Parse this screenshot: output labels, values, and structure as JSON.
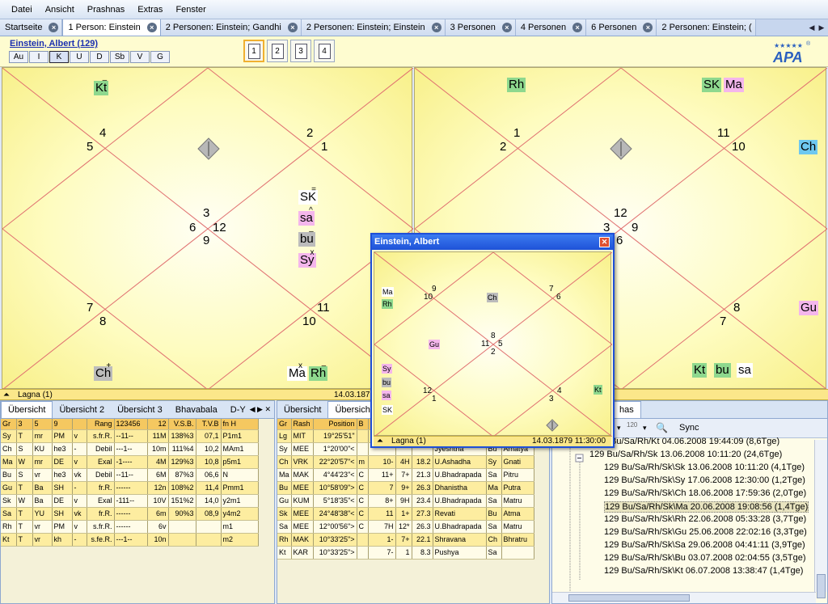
{
  "menu": [
    "Datei",
    "Ansicht",
    "Prashnas",
    "Extras",
    "Fenster"
  ],
  "tabs": [
    {
      "label": "Startseite",
      "active": false
    },
    {
      "label": "1 Person: Einstein",
      "active": true
    },
    {
      "label": "2 Personen: Einstein; Gandhi",
      "active": false
    },
    {
      "label": "2 Personen: Einstein; Einstein",
      "active": false
    },
    {
      "label": "3 Personen",
      "active": false
    },
    {
      "label": "4 Personen",
      "active": false
    },
    {
      "label": "6 Personen",
      "active": false
    },
    {
      "label": "2 Personen: Einstein; (",
      "active": false
    }
  ],
  "header": {
    "person": "Einstein, Albert (129)",
    "divisions": [
      "Au",
      "I",
      "K",
      "U",
      "D",
      "Sb",
      "V",
      "G"
    ],
    "selected_division": "K",
    "pages": [
      "1",
      "2",
      "3",
      "4"
    ],
    "selected_page": "1",
    "logo": "APA",
    "logo_reg": "®"
  },
  "left_chart": {
    "houses": [
      "4",
      "5",
      "2",
      "1",
      "3",
      "6",
      "12",
      "9",
      "7",
      "8",
      "11",
      "10"
    ],
    "planets": [
      {
        "name": "Kt",
        "mark": "–",
        "bg": "#8ed88e"
      },
      {
        "name": "SK",
        "mark": "=",
        "bg": "#ffffff"
      },
      {
        "name": "sa",
        "mark": "^",
        "bg": "#f4b6ec"
      },
      {
        "name": "bu",
        "mark": "–",
        "bg": "#bcbcbc"
      },
      {
        "name": "Sy",
        "mark": "x",
        "bg": "#f4b6ec"
      },
      {
        "name": "Ch",
        "mark": "+",
        "bg": "#bcbcbc"
      },
      {
        "name": "Ma",
        "mark": "x",
        "bg": "#ffffff"
      },
      {
        "name": "Rh",
        "mark": "–",
        "bg": "#8ed88e"
      }
    ]
  },
  "right_chart": {
    "houses": [
      "1",
      "2",
      "11",
      "10",
      "12",
      "3",
      "9",
      "6",
      "8",
      "7"
    ],
    "planets": [
      {
        "name": "Rh",
        "bg": "#8ed88e"
      },
      {
        "name": "SK",
        "bg": "#8ed88e"
      },
      {
        "name": "Ma",
        "bg": "#f4b6ec"
      },
      {
        "name": "Ch",
        "bg": "#6ec8f0"
      },
      {
        "name": "Gu",
        "bg": "#f4b6ec"
      },
      {
        "name": "Kt",
        "bg": "#8ed88e"
      },
      {
        "name": "bu",
        "bg": "#8ed88e"
      },
      {
        "name": "sa",
        "bg": "#ffffff"
      }
    ]
  },
  "chart_status": {
    "label": "Lagna (1)",
    "date": "14.03.1879"
  },
  "panel1": {
    "tabs": [
      "Übersicht",
      "Übersicht 2",
      "Übersicht 3",
      "Bhavabala",
      "D-Y"
    ],
    "header": [
      "Gr",
      "3",
      "5",
      "9",
      "",
      "",
      "Rang",
      "123456",
      "12",
      "V.S.B.",
      "T.V.B",
      "fn H"
    ],
    "rows": [
      [
        "Sy",
        "T",
        "mr",
        "PM",
        "v",
        "s.fr.R.",
        "--11--",
        "11M",
        "138%3",
        "07,1",
        "P1m1"
      ],
      [
        "Ch",
        "S",
        "KU",
        "he3",
        "-",
        "Debil",
        "---1--",
        "10m",
        "111%4",
        "10,2",
        "MAm1"
      ],
      [
        "Ma",
        "W",
        "mr",
        "DE",
        "v",
        "Exal",
        "-1----",
        "4M",
        "129%3",
        "10,8",
        "p5m1"
      ],
      [
        "Bu",
        "S",
        "vr",
        "he3",
        "vk",
        "Debil",
        "--11--",
        "6M",
        "87%3",
        "06,6",
        "N"
      ],
      [
        "Gu",
        "T",
        "Ba",
        "SH",
        "-",
        "fr.R.",
        "------",
        "12n",
        "108%2",
        "11,4",
        "Pmm1"
      ],
      [
        "Sk",
        "W",
        "Ba",
        "DE",
        "v",
        "Exal",
        "-111--",
        "10V",
        "151%2",
        "14,0",
        "y2m1"
      ],
      [
        "Sa",
        "T",
        "YU",
        "SH",
        "vk",
        "fr.R.",
        "------",
        "6m",
        "90%3",
        "08,9",
        "y4m2"
      ],
      [
        "Rh",
        "T",
        "vr",
        "PM",
        "v",
        "s.fr.R.",
        "------",
        "6v",
        "",
        "",
        "m1"
      ],
      [
        "Kt",
        "T",
        "vr",
        "kh",
        "-",
        "s.fe.R.",
        "---1--",
        "10n",
        "",
        "",
        "m2"
      ]
    ]
  },
  "panel2": {
    "tabs": [
      "Übersicht",
      "Übersicht"
    ],
    "header": [
      "Gr",
      "Rash",
      "Position",
      "B"
    ],
    "rows": [
      [
        "Lg",
        "MIT",
        "19°25'51\"",
        "",
        "",
        "",
        "",
        "",
        "",
        ""
      ],
      [
        "Sy",
        "MEE",
        "1°20'00\"<",
        "",
        "",
        "",
        "",
        "Jyeshtha",
        "Bu",
        "Amatya"
      ],
      [
        "Ch",
        "VRK",
        "22°20'57\"<",
        "m",
        "10-",
        "4H",
        "18.2",
        "U.Ashadha",
        "Sy",
        "Gnati"
      ],
      [
        "Ma",
        "MAK",
        "4°44'23\"<",
        "C",
        "11+",
        "7+",
        "21.3",
        "U.Bhadrapada",
        "Sa",
        "Pitru"
      ],
      [
        "Bu",
        "MEE",
        "10°58'09\">",
        "C",
        "7",
        "9+",
        "26.3",
        "Dhanistha",
        "Ma",
        "Putra"
      ],
      [
        "Gu",
        "KUM",
        "5°18'35\"<",
        "C",
        "8+",
        "9H",
        "23.4",
        "U.Bhadrapada",
        "Sa",
        "Matru"
      ],
      [
        "Sk",
        "MEE",
        "24°48'38\"<",
        "C",
        "11",
        "1+",
        "27.3",
        "Revati",
        "Bu",
        "Atma"
      ],
      [
        "Sa",
        "MEE",
        "12°00'56\">",
        "C",
        "7H",
        "12*",
        "26.3",
        "U.Bhadrapada",
        "Sa",
        "Matru"
      ],
      [
        "Rh",
        "MAK",
        "10°33'25\">",
        "",
        "1-",
        "7+",
        "22.1",
        "Shravana",
        "Ch",
        "Bhratru"
      ],
      [
        "Kt",
        "KAR",
        "10°33'25\">",
        "",
        "7-",
        "1",
        "8.3",
        "Pushya",
        "Sa",
        ""
      ]
    ]
  },
  "panel3": {
    "tab_suffix": "has",
    "toolbar": {
      "sync": "Sync",
      "zoom": "120"
    },
    "items": [
      {
        "text": "Bu/Sa/Rh/Kt 04.06.2008 19:44:09 (8,6Tge)",
        "level": 1
      },
      {
        "text": "129 Bu/Sa/Rh/Sk 13.06.2008 10:11:20 (24,6Tge)",
        "level": 1
      },
      {
        "text": "129 Bu/Sa/Rh/Sk\\Sk 13.06.2008 10:11:20 (4,1Tge)",
        "level": 2
      },
      {
        "text": "129 Bu/Sa/Rh/Sk\\Sy 17.06.2008 12:30:00 (1,2Tge)",
        "level": 2
      },
      {
        "text": "129 Bu/Sa/Rh/Sk\\Ch 18.06.2008 17:59:36 (2,0Tge)",
        "level": 2
      },
      {
        "text": "129 Bu/Sa/Rh/Sk\\Ma 20.06.2008 19:08:56 (1,4Tge)",
        "level": 2,
        "sel": true
      },
      {
        "text": "129 Bu/Sa/Rh/Sk\\Rh 22.06.2008 05:33:28 (3,7Tge)",
        "level": 2
      },
      {
        "text": "129 Bu/Sa/Rh/Sk\\Gu 25.06.2008 22:02:16 (3,3Tge)",
        "level": 2
      },
      {
        "text": "129 Bu/Sa/Rh/Sk\\Sa 29.06.2008 04:41:11 (3,9Tge)",
        "level": 2
      },
      {
        "text": "129 Bu/Sa/Rh/Sk\\Bu 03.07.2008 02:04:55 (3,5Tge)",
        "level": 2
      },
      {
        "text": "129 Bu/Sa/Rh/Sk\\Kt 06.07.2008 13:38:47 (1,4Tge)",
        "level": 2
      }
    ]
  },
  "popup": {
    "title": "Einstein, Albert",
    "houses": [
      "9",
      "10",
      "7",
      "6",
      "8",
      "11",
      "5",
      "2",
      "12",
      "1",
      "4",
      "3"
    ],
    "planets": [
      {
        "name": "Ma",
        "bg": "#ffffff"
      },
      {
        "name": "Rh",
        "bg": "#8ed88e"
      },
      {
        "name": "Ch",
        "bg": "#bcbcbc"
      },
      {
        "name": "Gu",
        "bg": "#f4b6ec"
      },
      {
        "name": "Sy",
        "bg": "#f4b6ec"
      },
      {
        "name": "bu",
        "bg": "#bcbcbc"
      },
      {
        "name": "sa",
        "bg": "#f4b6ec"
      },
      {
        "name": "SK",
        "bg": "#ffffff"
      },
      {
        "name": "Kt",
        "bg": "#8ed88e"
      }
    ],
    "status_label": "Lagna (1)",
    "status_date": "14.03.1879 11:30:00"
  }
}
